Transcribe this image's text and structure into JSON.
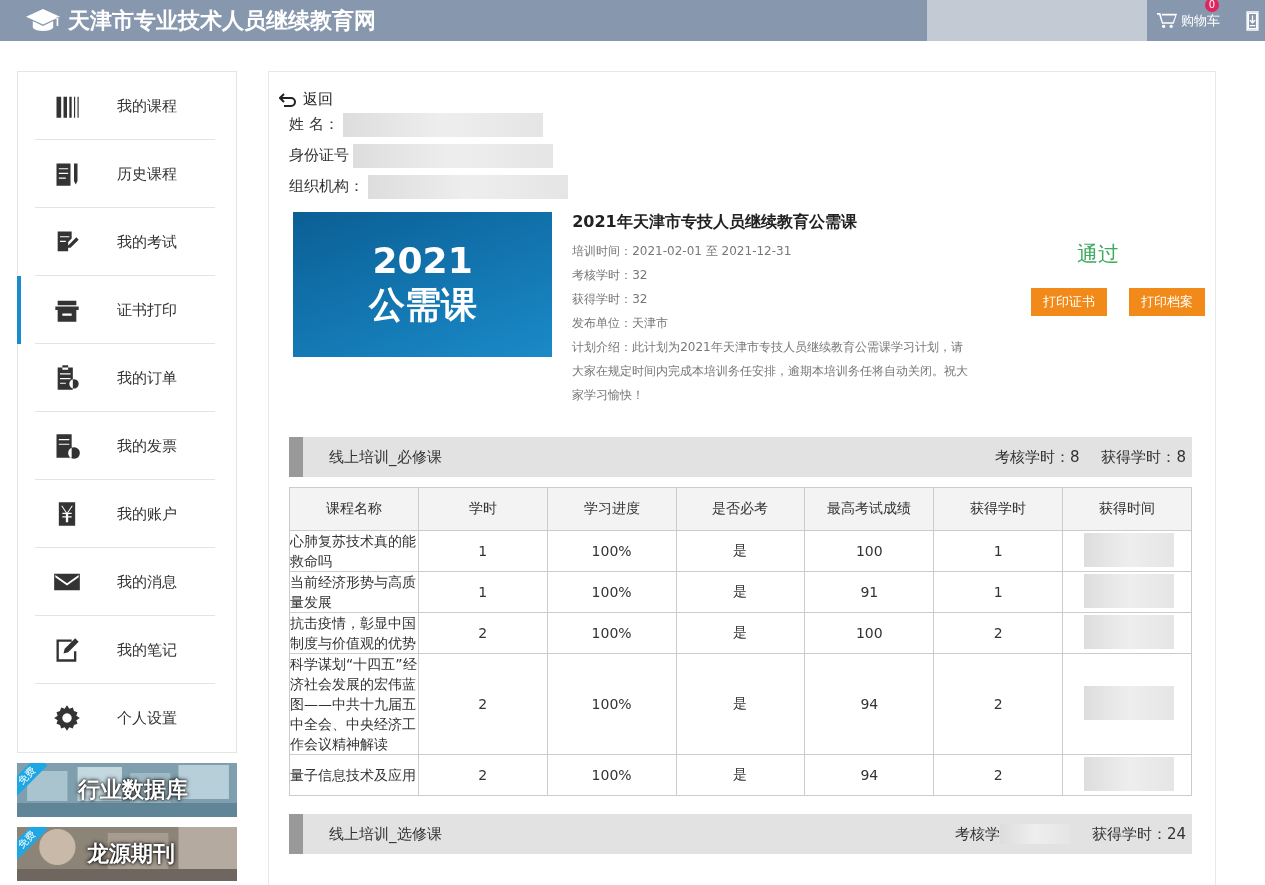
{
  "header": {
    "site_title": "天津市专业技术人员继续教育网",
    "user_obscured": true,
    "cart_label": "购物车",
    "cart_count": "0"
  },
  "sidebar": {
    "items": [
      {
        "label": "我的课程",
        "selected": false
      },
      {
        "label": "历史课程",
        "selected": false
      },
      {
        "label": "我的考试",
        "selected": false
      },
      {
        "label": "证书打印",
        "selected": true
      },
      {
        "label": "我的订单",
        "selected": false
      },
      {
        "label": "我的发票",
        "selected": false
      },
      {
        "label": "我的账户",
        "selected": false
      },
      {
        "label": "我的消息",
        "selected": false
      },
      {
        "label": "我的笔记",
        "selected": false
      },
      {
        "label": "个人设置",
        "selected": false
      }
    ],
    "banners": [
      {
        "badge": "免费",
        "title": "行业数据库"
      },
      {
        "badge": "免费",
        "title": "龙源期刊"
      }
    ]
  },
  "main": {
    "back": "返回",
    "info": [
      {
        "label": "姓 名：",
        "obscured": true
      },
      {
        "label": "身份证号",
        "obscured": true
      },
      {
        "label": "组织机构：",
        "obscured": true
      }
    ],
    "course": {
      "cover_year": "2021",
      "cover_title": "公需课",
      "title": "2021年天津市专技人员继续教育公需课",
      "details": [
        "培训时间：2021-02-01 至 2021-12-31",
        "考核学时：32",
        "获得学时：32",
        "发布单位：天津市",
        "计划介绍：此计划为2021年天津市专技人员继续教育公需课学习计划，请大家在规定时间内完成本培训务任安排，逾期本培训务任将自动关闭。祝大家学习愉快！"
      ],
      "status": "通过",
      "buttons": [
        "打印证书",
        "打印档案"
      ]
    },
    "sections": [
      {
        "title": "线上培训_必修课",
        "required_hours": "考核学时：8",
        "earned_hours": "获得学时：8",
        "columns": [
          "课程名称",
          "学时",
          "学习进度",
          "是否必考",
          "最高考试成绩",
          "获得学时",
          "获得时间"
        ],
        "rows": [
          {
            "name": "心肺复苏技术真的能救命吗",
            "hours": "1",
            "progress": "100%",
            "required": "是",
            "score": "100",
            "earned": "1",
            "time_obscured": true
          },
          {
            "name": "当前经济形势与高质量发展",
            "hours": "1",
            "progress": "100%",
            "required": "是",
            "score": "91",
            "earned": "1",
            "time_obscured": true
          },
          {
            "name": "抗击疫情，彰显中国制度与价值观的优势",
            "hours": "2",
            "progress": "100%",
            "required": "是",
            "score": "100",
            "earned": "2",
            "time_obscured": true
          },
          {
            "name": "科学谋划“十四五”经济社会发展的宏伟蓝图——中共十九届五中全会、中央经济工作会议精神解读",
            "hours": "2",
            "progress": "100%",
            "required": "是",
            "score": "94",
            "earned": "2",
            "time_obscured": true
          },
          {
            "name": "量子信息技术及应用",
            "hours": "2",
            "progress": "100%",
            "required": "是",
            "score": "94",
            "earned": "2",
            "time_obscured": true
          }
        ]
      },
      {
        "title": "线上培训_选修课",
        "required_hours": "考核学",
        "required_obscured": true,
        "earned_hours": "获得学时：24"
      }
    ]
  }
}
